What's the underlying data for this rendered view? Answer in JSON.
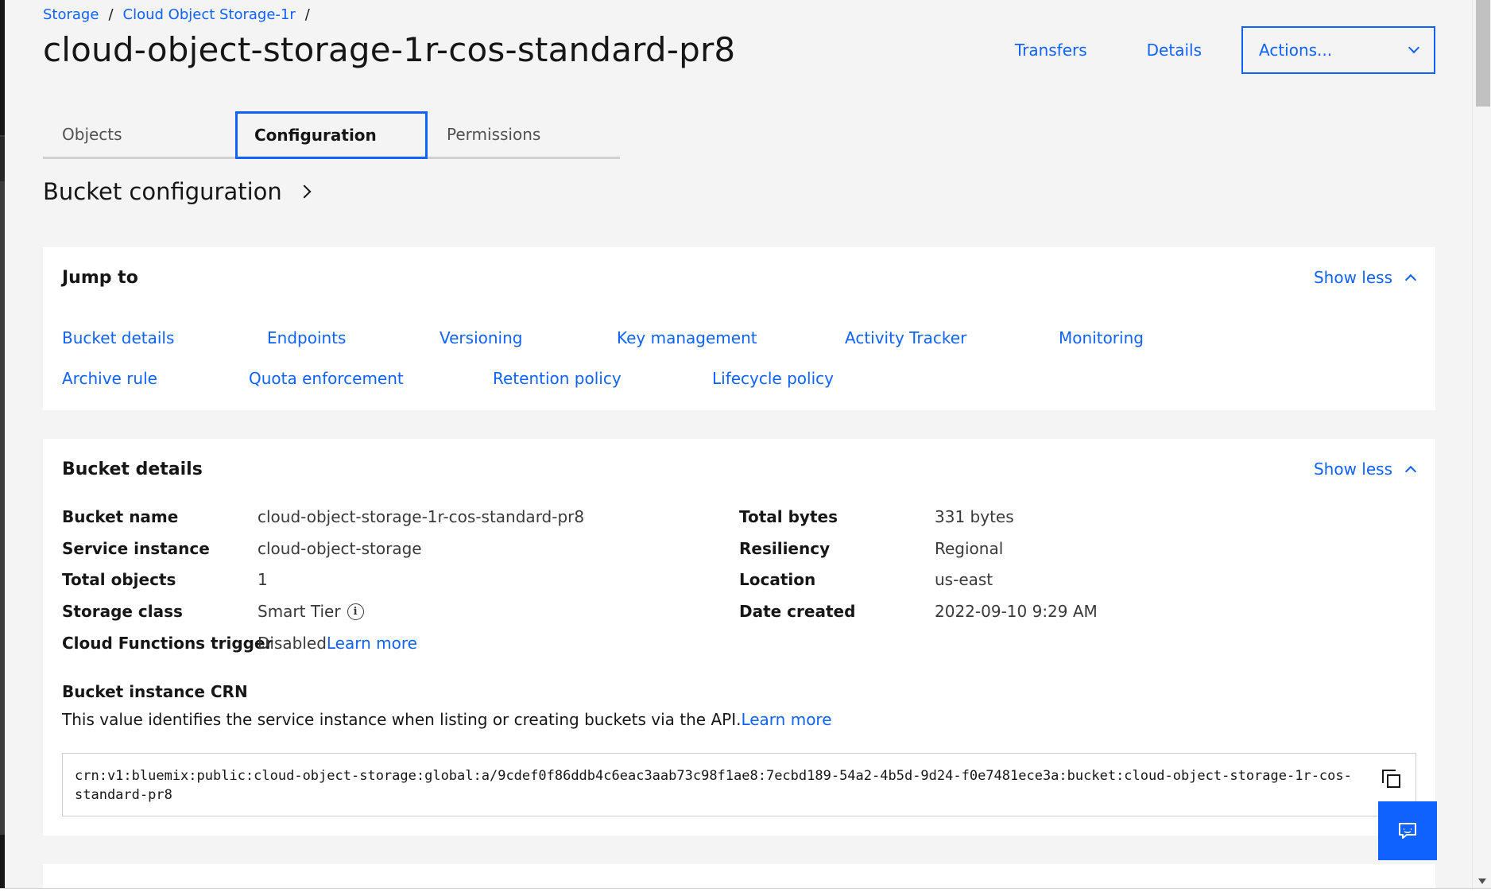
{
  "breadcrumb": {
    "items": [
      "Storage",
      "Cloud Object Storage-1r"
    ],
    "separator": "/"
  },
  "page_title": "cloud-object-storage-1r-cos-standard-pr8",
  "header": {
    "transfers_label": "Transfers",
    "details_label": "Details",
    "actions_label": "Actions..."
  },
  "tabs": [
    {
      "label": "Objects",
      "active": false
    },
    {
      "label": "Configuration",
      "active": true
    },
    {
      "label": "Permissions",
      "active": false
    }
  ],
  "section_heading": "Bucket configuration",
  "jump_to": {
    "title": "Jump to",
    "toggle_label": "Show less",
    "links": [
      "Bucket details",
      "Endpoints",
      "Versioning",
      "Key management",
      "Activity Tracker",
      "Monitoring",
      "Archive rule",
      "Quota enforcement",
      "Retention policy",
      "Lifecycle policy"
    ]
  },
  "bucket_details": {
    "title": "Bucket details",
    "toggle_label": "Show less",
    "left": [
      {
        "label": "Bucket name",
        "value": "cloud-object-storage-1r-cos-standard-pr8"
      },
      {
        "label": "Service instance",
        "value": "cloud-object-storage"
      },
      {
        "label": "Total objects",
        "value": "1"
      },
      {
        "label": "Storage class",
        "value": "Smart Tier"
      },
      {
        "label": "Cloud Functions trigger",
        "value": "Disabled",
        "link": "Learn more"
      }
    ],
    "right": [
      {
        "label": "Total bytes",
        "value": "331 bytes"
      },
      {
        "label": "Resiliency",
        "value": "Regional"
      },
      {
        "label": "Location",
        "value": "us-east"
      },
      {
        "label": "Date created",
        "value": "2022-09-10 9:29 AM"
      }
    ],
    "crn": {
      "title": "Bucket instance CRN",
      "description": "This value identifies the service instance when listing or creating buckets via the API.",
      "learn_more": "Learn more",
      "value": "crn:v1:bluemix:public:cloud-object-storage:global:a/9cdef0f86ddb4c6eac3aab73c98f1ae8:7ecbd189-54a2-4b5d-9d24-f0e7481ece3a:bucket:cloud-object-storage-1r-cos-standard-pr8"
    }
  },
  "colors": {
    "accent": "#0f62fe",
    "background": "#f4f4f4",
    "card": "#ffffff",
    "text": "#161616"
  },
  "icons": [
    "chevron-down-icon",
    "chevron-right-icon",
    "chevron-up-icon",
    "info-icon",
    "copy-icon",
    "feedback-icon"
  ]
}
